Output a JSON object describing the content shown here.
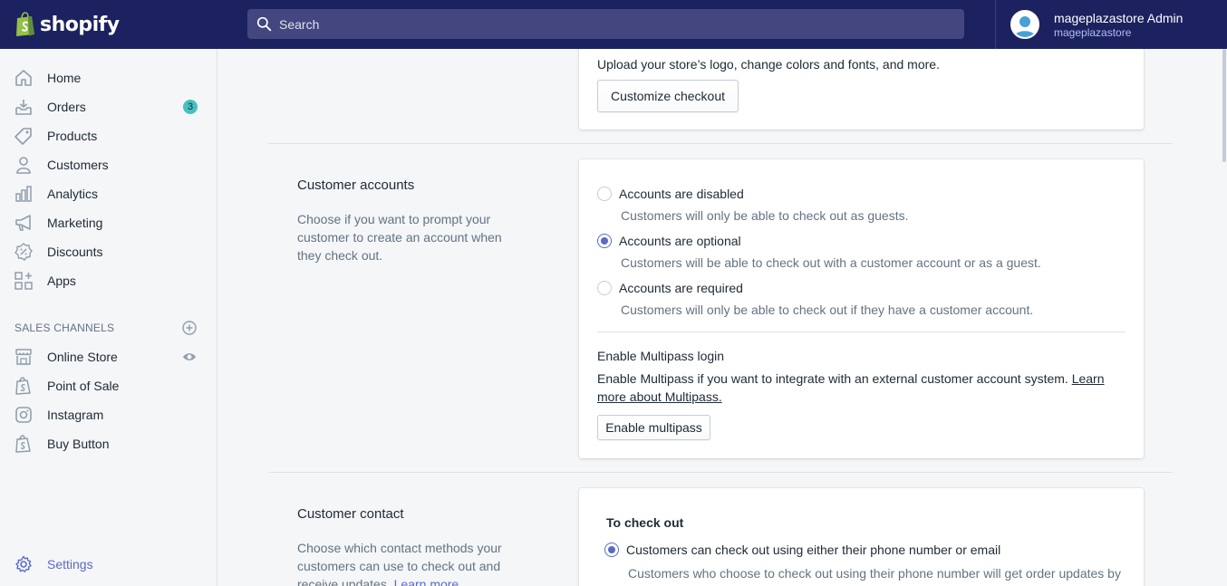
{
  "app": {
    "logo_text": "shopify"
  },
  "header": {
    "search_placeholder": "Search",
    "account_name": "mageplazastore Admin",
    "account_store": "mageplazastore"
  },
  "sidebar": {
    "items": [
      {
        "label": "Home",
        "icon": "home-icon"
      },
      {
        "label": "Orders",
        "icon": "orders-icon",
        "badge": "3"
      },
      {
        "label": "Products",
        "icon": "tag-icon"
      },
      {
        "label": "Customers",
        "icon": "person-icon"
      },
      {
        "label": "Analytics",
        "icon": "bar-chart-icon"
      },
      {
        "label": "Marketing",
        "icon": "megaphone-icon"
      },
      {
        "label": "Discounts",
        "icon": "discount-icon"
      },
      {
        "label": "Apps",
        "icon": "apps-icon"
      }
    ],
    "channels_heading": "SALES CHANNELS",
    "channels": [
      {
        "label": "Online Store",
        "icon": "store-icon"
      },
      {
        "label": "Point of Sale",
        "icon": "shopify-bag-icon"
      },
      {
        "label": "Instagram",
        "icon": "instagram-icon"
      },
      {
        "label": "Buy Button",
        "icon": "shopify-bag-icon"
      }
    ],
    "settings_label": "Settings"
  },
  "checkout_style": {
    "description": "Upload your store’s logo, change colors and fonts, and more.",
    "button_label": "Customize checkout"
  },
  "customer_accounts": {
    "title": "Customer accounts",
    "description": "Choose if you want to prompt your customer to create an account when they check out.",
    "options": [
      {
        "label": "Accounts are disabled",
        "help": "Customers will only be able to check out as guests.",
        "checked": false
      },
      {
        "label": "Accounts are optional",
        "help": "Customers will be able to check out with a customer account or as a guest.",
        "checked": true
      },
      {
        "label": "Accounts are required",
        "help": "Customers will only be able to check out if they have a customer account.",
        "checked": false
      }
    ],
    "multipass_heading": "Enable Multipass login",
    "multipass_text": "Enable Multipass if you want to integrate with an external customer account system.",
    "multipass_link_1": "Learn",
    "multipass_link_2": "more about Multipass.",
    "multipass_button": "Enable multipass"
  },
  "customer_contact": {
    "title": "Customer contact",
    "description": "Choose which contact methods your customers can use to check out and receive updates.",
    "learn_more": "Learn more",
    "subheading": "To check out",
    "option_label": "Customers can check out using either their phone number or email",
    "option_help": "Customers who choose to check out using their phone number will get order updates by SMS. This means that their email or mailing address might not be..."
  },
  "colors": {
    "topbar": "#1c2260",
    "accent": "#5c6ac4",
    "badge": "#47c1bf"
  }
}
